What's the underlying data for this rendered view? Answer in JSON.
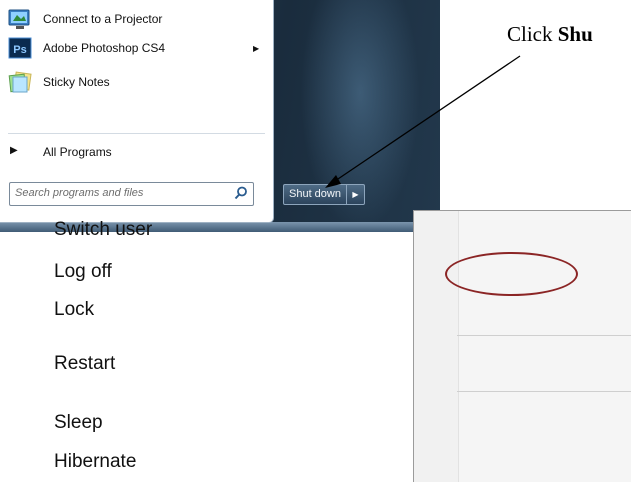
{
  "start_menu": {
    "programs": [
      {
        "label": "Connect to a Projector",
        "icon": "projector-icon",
        "has_submenu": false
      },
      {
        "label": "Adobe Photoshop CS4",
        "icon": "photoshop-icon",
        "has_submenu": true
      },
      {
        "label": "Sticky Notes",
        "icon": "sticky-notes-icon",
        "has_submenu": false
      }
    ],
    "all_programs": "All Programs",
    "search_placeholder": "Search programs and files",
    "shut_down_label": "Shut down"
  },
  "instruction": {
    "prefix": "Click ",
    "bold": "Shu"
  },
  "power_menu": {
    "items": [
      "Switch user",
      "Log off",
      "Lock",
      "Restart",
      "Sleep",
      "Hibernate"
    ],
    "highlighted": "Log off"
  },
  "colors": {
    "highlight_ring": "#8b2525",
    "photoshop_blue": "#1e5ea8"
  }
}
